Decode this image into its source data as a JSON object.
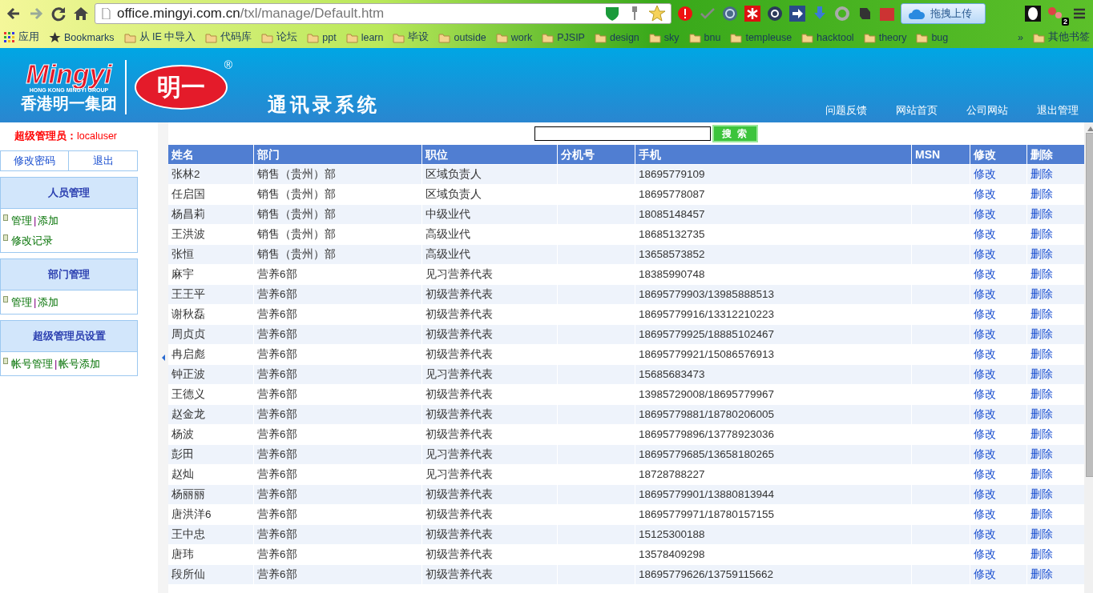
{
  "browser": {
    "url_host": "office.mingyi.com.cn",
    "url_path": "/txl/manage/Default.htm",
    "upload_button": "拖拽上传",
    "extension_badge": "2",
    "bookmarks": [
      {
        "kind": "apps",
        "label": "应用"
      },
      {
        "kind": "star",
        "label": "Bookmarks"
      },
      {
        "kind": "folder",
        "label": "从 IE 中导入"
      },
      {
        "kind": "folder",
        "label": "代码库"
      },
      {
        "kind": "folder",
        "label": "论坛"
      },
      {
        "kind": "folder",
        "label": "ppt"
      },
      {
        "kind": "folder",
        "label": "learn"
      },
      {
        "kind": "folder",
        "label": "毕设"
      },
      {
        "kind": "folder",
        "label": "outside"
      },
      {
        "kind": "folder",
        "label": "work"
      },
      {
        "kind": "folder",
        "label": "PJSIP"
      },
      {
        "kind": "folder",
        "label": "design"
      },
      {
        "kind": "folder",
        "label": "sky"
      },
      {
        "kind": "folder",
        "label": "bnu"
      },
      {
        "kind": "folder",
        "label": "templeuse"
      },
      {
        "kind": "folder",
        "label": "hacktool"
      },
      {
        "kind": "folder",
        "label": "theory"
      },
      {
        "kind": "folder",
        "label": "bug"
      }
    ],
    "more": "»",
    "other_bookmarks": "其他书签"
  },
  "header": {
    "logo": {
      "brand": "Mingyi",
      "tagline": "HONG KONG MINGYI GROUP",
      "group": "香港明一集团",
      "mark": "明一",
      "registered": "®"
    },
    "title": "通讯录系统",
    "nav": [
      "问题反馈",
      "网站首页",
      "公司网站",
      "退出管理"
    ]
  },
  "sidebar": {
    "admin": "**超级管理员：**localuser",
    "account_links": [
      "修改密码",
      "退出"
    ],
    "sections": [
      {
        "title": "人员管理",
        "lines": [
          {
            "links": [
              "管理",
              "添加"
            ],
            "separator": "|"
          },
          {
            "links": [
              "修改记录"
            ]
          }
        ]
      },
      {
        "title": "部门管理",
        "lines": [
          {
            "links": [
              "管理",
              "添加"
            ],
            "separator": "|"
          }
        ]
      },
      {
        "title": "超级管理员设置",
        "lines": [
          {
            "links": [
              "帐号管理",
              "帐号添加"
            ],
            "separator": "|"
          }
        ]
      }
    ]
  },
  "search": {
    "button": "搜 索"
  },
  "table": {
    "columns": [
      "姓名",
      "部门",
      "职位",
      "分机号",
      "手机",
      "MSN",
      "修改",
      "删除"
    ],
    "rows": [
      [
        "张林2",
        "销售（贵州）部",
        "区域负责人",
        "",
        "18695779109",
        "",
        "修改",
        "删除"
      ],
      [
        "任启国",
        "销售（贵州）部",
        "区域负责人",
        "",
        "18695778087",
        "",
        "修改",
        "删除"
      ],
      [
        "杨昌莉",
        "销售（贵州）部",
        "中级业代",
        "",
        "18085148457",
        "",
        "修改",
        "删除"
      ],
      [
        "王洪波",
        "销售（贵州）部",
        "高级业代",
        "",
        "18685132735",
        "",
        "修改",
        "删除"
      ],
      [
        "张恒",
        "销售（贵州）部",
        "高级业代",
        "",
        "13658573852",
        "",
        "修改",
        "删除"
      ],
      [
        "麻宇",
        "营养6部",
        "见习营养代表",
        "",
        "18385990748",
        "",
        "修改",
        "删除"
      ],
      [
        "王王平",
        "营养6部",
        "初级营养代表",
        "",
        "18695779903/13985888513",
        "",
        "修改",
        "删除"
      ],
      [
        "谢秋磊",
        "营养6部",
        "初级营养代表",
        "",
        "18695779916/13312210223",
        "",
        "修改",
        "删除"
      ],
      [
        "周贞贞",
        "营养6部",
        "初级营养代表",
        "",
        "18695779925/18885102467",
        "",
        "修改",
        "删除"
      ],
      [
        "冉启彪",
        "营养6部",
        "初级营养代表",
        "",
        "18695779921/15086576913",
        "",
        "修改",
        "删除"
      ],
      [
        "钟正波",
        "营养6部",
        "见习营养代表",
        "",
        "15685683473",
        "",
        "修改",
        "删除"
      ],
      [
        "王德义",
        "营养6部",
        "初级营养代表",
        "",
        "13985729008/18695779967",
        "",
        "修改",
        "删除"
      ],
      [
        "赵金龙",
        "营养6部",
        "初级营养代表",
        "",
        "18695779881/18780206005",
        "",
        "修改",
        "删除"
      ],
      [
        "杨波",
        "营养6部",
        "初级营养代表",
        "",
        "18695779896/13778923036",
        "",
        "修改",
        "删除"
      ],
      [
        "彭田",
        "营养6部",
        "见习营养代表",
        "",
        "18695779685/13658180265",
        "",
        "修改",
        "删除"
      ],
      [
        "赵灿",
        "营养6部",
        "见习营养代表",
        "",
        "18728788227",
        "",
        "修改",
        "删除"
      ],
      [
        "杨丽丽",
        "营养6部",
        "初级营养代表",
        "",
        "18695779901/13880813944",
        "",
        "修改",
        "删除"
      ],
      [
        "唐洪洋6",
        "营养6部",
        "初级营养代表",
        "",
        "18695779971/18780157155",
        "",
        "修改",
        "删除"
      ],
      [
        "王中忠",
        "营养6部",
        "初级营养代表",
        "",
        "15125300188",
        "",
        "修改",
        "删除"
      ],
      [
        "唐玮",
        "营养6部",
        "初级营养代表",
        "",
        "13578409298",
        "",
        "修改",
        "删除"
      ],
      [
        "段所仙",
        "营养6部",
        "初级营养代表",
        "",
        "18695779626/13759115662",
        "",
        "修改",
        "删除"
      ]
    ]
  }
}
